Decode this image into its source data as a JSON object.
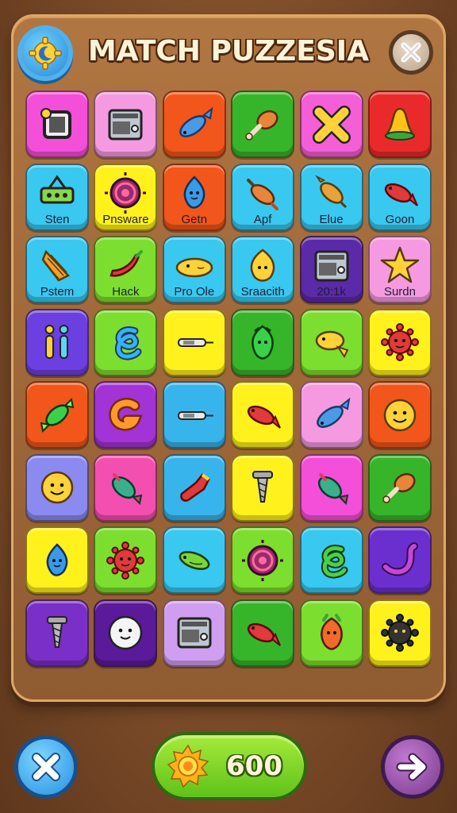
{
  "header": {
    "title": "MATCH PUZZESIA",
    "settings_icon": "gear-moon-icon",
    "close_icon": "close-icon"
  },
  "grid": {
    "rows": [
      [
        {
          "icon": "framed-box",
          "color": "#f34fd9",
          "label": ""
        },
        {
          "icon": "appliance",
          "color": "#f59ae0",
          "label": ""
        },
        {
          "icon": "blue-fish",
          "color": "#f2561a",
          "label": ""
        },
        {
          "icon": "drumstick",
          "color": "#36b52a",
          "label": ""
        },
        {
          "icon": "yellow-x",
          "color": "#f45ed6",
          "label": ""
        },
        {
          "icon": "bell",
          "color": "#ea2a2a",
          "label": ""
        }
      ],
      [
        {
          "icon": "hanging-sign",
          "color": "#38c8f0",
          "label": "Sten"
        },
        {
          "icon": "purple-swirl",
          "color": "#fff21c",
          "label": "Pnsware"
        },
        {
          "icon": "blue-drop-creature",
          "color": "#f2561a",
          "label": "Getn"
        },
        {
          "icon": "pepper",
          "color": "#38c8f0",
          "label": "Apf"
        },
        {
          "icon": "squid",
          "color": "#38c8f0",
          "label": "Elue"
        },
        {
          "icon": "red-fish",
          "color": "#38c8f0",
          "label": "Goon"
        }
      ],
      [
        {
          "icon": "shell",
          "color": "#38c8f0",
          "label": "Pstem"
        },
        {
          "icon": "chili",
          "color": "#7cde2e",
          "label": "Hack"
        },
        {
          "icon": "yellow-pill",
          "color": "#38c8f0",
          "label": "Pro Ole"
        },
        {
          "icon": "yellow-drop",
          "color": "#38c8f0",
          "label": "Sraacith"
        },
        {
          "icon": "appliance",
          "color": "#5b2aa8",
          "label": "20:1k"
        },
        {
          "icon": "star",
          "color": "#f59ae0",
          "label": "Surdn"
        }
      ],
      [
        {
          "icon": "ii-bars",
          "color": "#6b3fe0",
          "label": ""
        },
        {
          "icon": "blue-coil",
          "color": "#7cde2e",
          "label": ""
        },
        {
          "icon": "needle",
          "color": "#fff21c",
          "label": ""
        },
        {
          "icon": "green-creature",
          "color": "#36b52a",
          "label": ""
        },
        {
          "icon": "yellow-fish",
          "color": "#7cde2e",
          "label": ""
        },
        {
          "icon": "red-sun",
          "color": "#fff21c",
          "label": ""
        }
      ],
      [
        {
          "icon": "green-candy",
          "color": "#f2561a",
          "label": ""
        },
        {
          "icon": "orange-g",
          "color": "#a233d6",
          "label": ""
        },
        {
          "icon": "needle",
          "color": "#38b4ec",
          "label": ""
        },
        {
          "icon": "red-fish",
          "color": "#fff21c",
          "label": ""
        },
        {
          "icon": "blue-fish",
          "color": "#f59ae0",
          "label": ""
        },
        {
          "icon": "smiley",
          "color": "#f2561a",
          "label": ""
        }
      ],
      [
        {
          "icon": "smiley",
          "color": "#8a8af0",
          "label": ""
        },
        {
          "icon": "teal-fish",
          "color": "#f34fb0",
          "label": ""
        },
        {
          "icon": "boot",
          "color": "#38b4ec",
          "label": ""
        },
        {
          "icon": "drill",
          "color": "#fff21c",
          "label": ""
        },
        {
          "icon": "teal-fish",
          "color": "#f34fd9",
          "label": ""
        },
        {
          "icon": "drumstick",
          "color": "#36b52a",
          "label": ""
        }
      ],
      [
        {
          "icon": "blue-drop-creature",
          "color": "#fff21c",
          "label": ""
        },
        {
          "icon": "red-sun",
          "color": "#7cde2e",
          "label": ""
        },
        {
          "icon": "green-fish",
          "color": "#38c8f0",
          "label": ""
        },
        {
          "icon": "purple-swirl",
          "color": "#7cde2e",
          "label": ""
        },
        {
          "icon": "green-coil",
          "color": "#38c8f0",
          "label": ""
        },
        {
          "icon": "purple-tentacle",
          "color": "#6b2fd0",
          "label": ""
        }
      ],
      [
        {
          "icon": "drill",
          "color": "#7a2fc8",
          "label": ""
        },
        {
          "icon": "white-face",
          "color": "#5a1a9a",
          "label": ""
        },
        {
          "icon": "appliance",
          "color": "#cf9ef0",
          "label": ""
        },
        {
          "icon": "red-fish",
          "color": "#36b52a",
          "label": ""
        },
        {
          "icon": "orange-creature",
          "color": "#7cde2e",
          "label": ""
        },
        {
          "icon": "black-sun",
          "color": "#fff21c",
          "label": ""
        }
      ]
    ]
  },
  "footer": {
    "close_icon": "close-icon",
    "score_icon": "sun-coin-icon",
    "score": "600",
    "next_icon": "arrow-right-icon"
  }
}
